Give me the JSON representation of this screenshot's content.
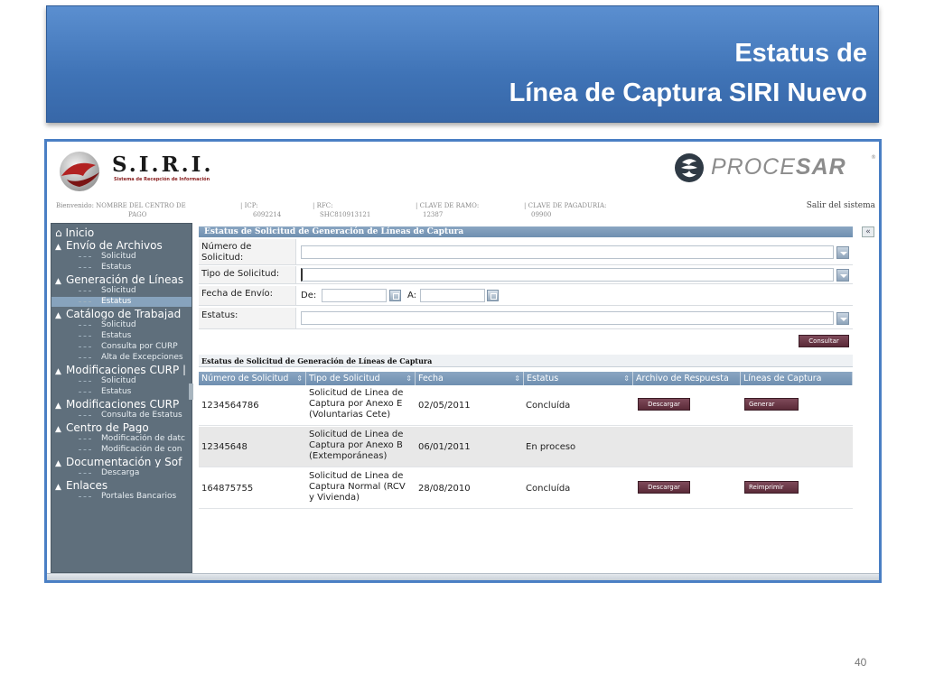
{
  "slide": {
    "title_line1": "Estatus de",
    "title_line2": "Línea de Captura SIRI Nuevo",
    "page_number": "40"
  },
  "app": {
    "logo_text": "S.I.R.I.",
    "logo_subtitle": "Sistema de Recepción de Información",
    "partner_logo_text_light": "PROCE",
    "partner_logo_text_bold": "SAR",
    "partner_logo_mark": "®",
    "logout_label": "Salir del sistema",
    "info": {
      "welcome_label": "Bienvenido:",
      "welcome_value_line1": "NOMBRE DEL CENTRO DE",
      "welcome_value_line2": "PAGO",
      "icp_label": "ICP:",
      "icp_value": "6092214",
      "rfc_label": "RFC:",
      "rfc_value": "SHC810913121",
      "ramo_label": "CLAVE DE RAMO:",
      "ramo_value": "12387",
      "pagaduria_label": "CLAVE DE PAGADURIA:",
      "pagaduria_value": "09900"
    }
  },
  "sidebar": {
    "home": "Inicio",
    "items": [
      {
        "type": "section",
        "label": "Envío de Archivos"
      },
      {
        "type": "sub",
        "label": "Solicitud"
      },
      {
        "type": "sub",
        "label": "Estatus"
      },
      {
        "type": "section",
        "label": "Generación de Líneas"
      },
      {
        "type": "sub",
        "label": "Solicitud"
      },
      {
        "type": "sub",
        "label": "Estatus",
        "active": true
      },
      {
        "type": "section",
        "label": "Catálogo de Trabajad"
      },
      {
        "type": "sub",
        "label": "Solicitud"
      },
      {
        "type": "sub",
        "label": "Estatus"
      },
      {
        "type": "sub",
        "label": "Consulta por CURP"
      },
      {
        "type": "sub",
        "label": "Alta de Excepciones"
      },
      {
        "type": "section",
        "label": "Modificaciones CURP |"
      },
      {
        "type": "sub",
        "label": "Solicitud"
      },
      {
        "type": "sub",
        "label": "Estatus"
      },
      {
        "type": "section",
        "label": "Modificaciones CURP"
      },
      {
        "type": "sub",
        "label": "Consulta de Estatus"
      },
      {
        "type": "section",
        "label": "Centro de Pago"
      },
      {
        "type": "sub",
        "label": "Modificación de datc"
      },
      {
        "type": "sub",
        "label": "Modificación de con"
      },
      {
        "type": "section",
        "label": "Documentación y Sof"
      },
      {
        "type": "sub",
        "label": "Descarga"
      },
      {
        "type": "section",
        "label": "Enlaces"
      },
      {
        "type": "sub",
        "label": "Portales Bancarios"
      }
    ]
  },
  "search_panel": {
    "title": "Estatus de Solicitud de Generación de Líneas de Captura",
    "collapse_glyph": "«",
    "numero_label": "Número de Solicitud:",
    "numero_value": "",
    "tipo_label": "Tipo de Solicitud:",
    "tipo_value": "",
    "fecha_label": "Fecha de Envío:",
    "de_label": "De:",
    "a_label": "A:",
    "fecha_de_value": "",
    "fecha_a_value": "",
    "estatus_label": "Estatus:",
    "estatus_value": "",
    "consultar_label": "Consultar"
  },
  "results": {
    "title": "Estatus de Solicitud de Generación de Líneas de Captura",
    "sort_glyph": "⇕",
    "columns": [
      "Número de Solicitud",
      "Tipo de Solicitud",
      "Fecha",
      "Estatus",
      "Archivo de Respuesta",
      "Líneas de Captura"
    ],
    "rows": [
      {
        "numero": "1234564786",
        "tipo_line1": "Solicitud de Linea de",
        "tipo_line2": "Captura por Anexo E",
        "tipo_line3": "(Voluntarias Cete)",
        "fecha": "02/05/2011",
        "estatus": "Concluída",
        "archivo": "Descargar",
        "lineas": "Generar"
      },
      {
        "numero": "12345648",
        "tipo_line1": "Solicitud de Linea de",
        "tipo_line2": "Captura por Anexo B",
        "tipo_line3": "(Extemporáneas)",
        "fecha": "06/01/2011",
        "estatus": "En proceso",
        "archivo": "",
        "lineas": ""
      },
      {
        "numero": "164875755",
        "tipo_line1": "Solicitud de Linea de",
        "tipo_line2": "Captura Normal (RCV",
        "tipo_line3": "y Vivienda)",
        "fecha": "28/08/2010",
        "estatus": "Concluída",
        "archivo": "Descargar",
        "lineas": "Reimprimir"
      }
    ]
  },
  "colors": {
    "banner": "#3f73b6",
    "sidebar": "#5f6f7c",
    "panel_header": "#7b99b8",
    "action_button": "#6a3646"
  }
}
